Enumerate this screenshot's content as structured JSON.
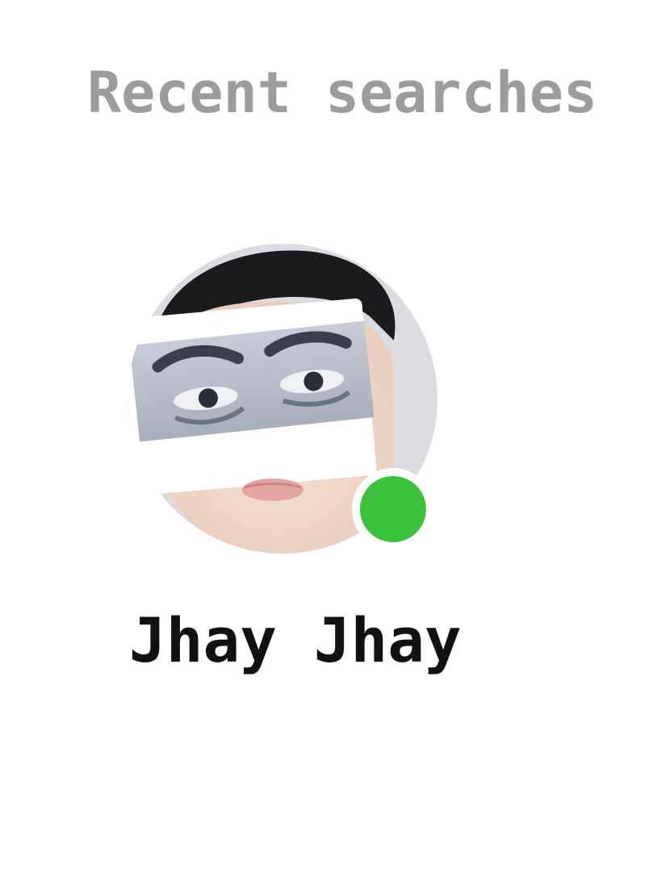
{
  "header": {
    "title": "Recent searches"
  },
  "recent_searches": [
    {
      "name": "Jhay Jhay",
      "online": true
    }
  ],
  "colors": {
    "title": "#9c9c9c",
    "name": "#111111",
    "online_status": "#3cc13c",
    "avatar_background": "#dcdce0"
  },
  "icons": {
    "status": "online-status-dot"
  }
}
